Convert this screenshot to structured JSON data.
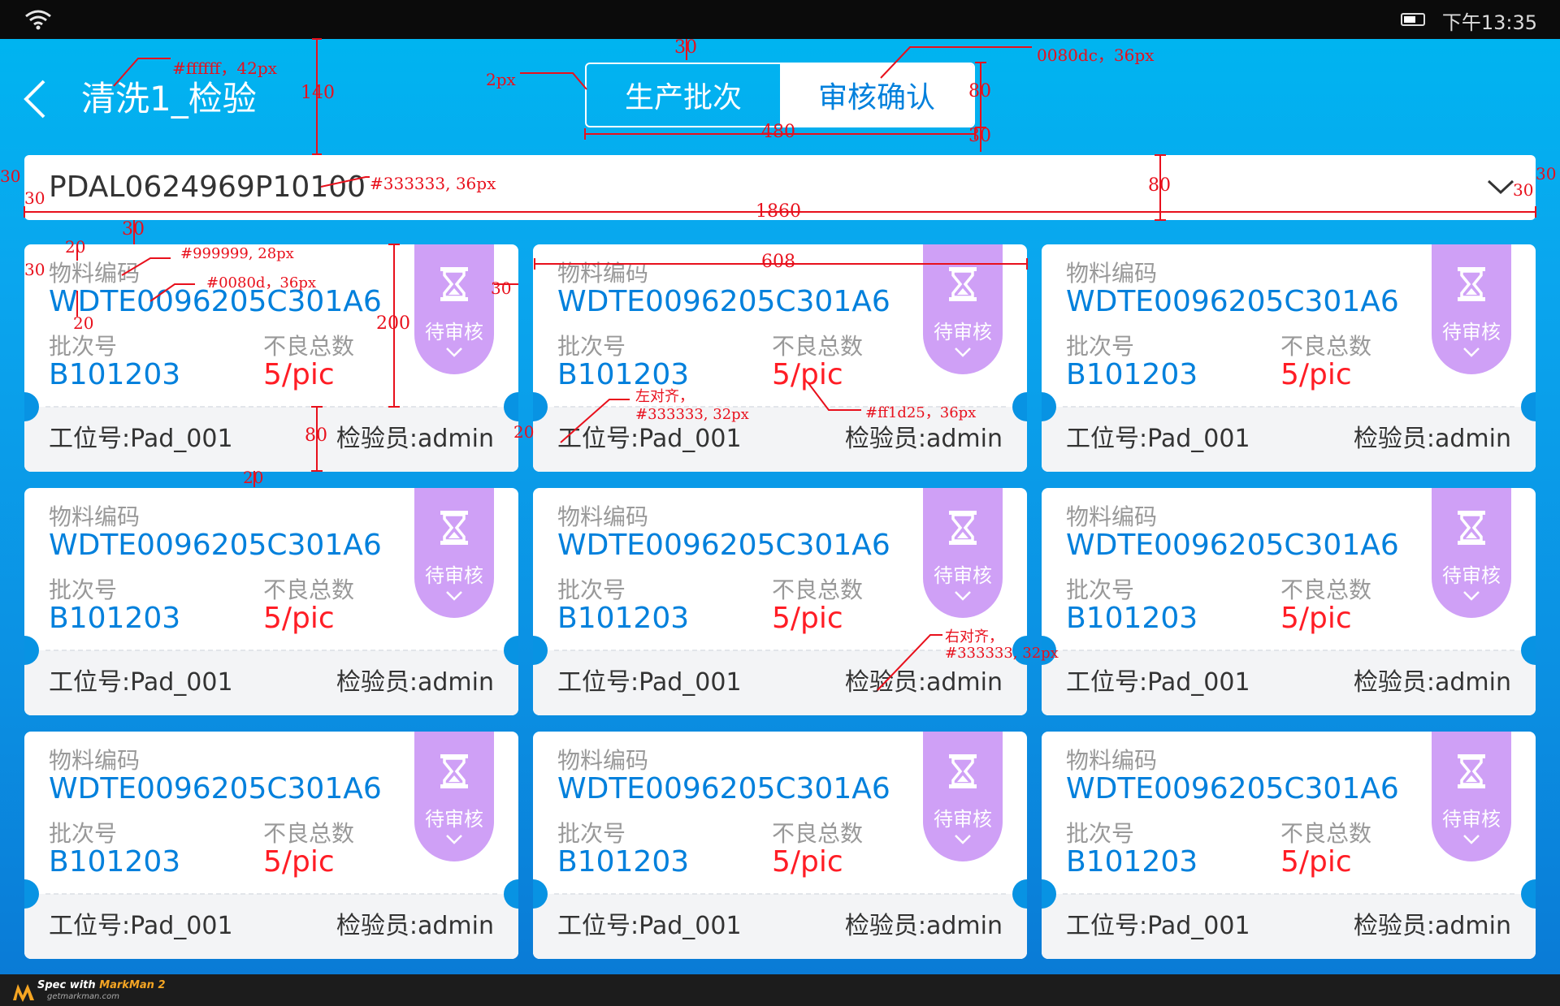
{
  "statusbar": {
    "time": "下午13:35"
  },
  "header": {
    "title": "清洗1_检验",
    "tabs": [
      {
        "label": "生产批次",
        "active": false
      },
      {
        "label": "审核确认",
        "active": true
      }
    ]
  },
  "selector": {
    "value": "PDAL0624969P10100"
  },
  "cards": [
    {
      "material_label": "物料编码",
      "material_code": "WDTE0096205C301A6",
      "batch_label": "批次号",
      "batch_no": "B101203",
      "defect_label": "不良总数",
      "defect_value": "5/pic",
      "station": "工位号:Pad_001",
      "inspector": "检验员:admin",
      "status": "待审核"
    },
    {
      "material_label": "物料编码",
      "material_code": "WDTE0096205C301A6",
      "batch_label": "批次号",
      "batch_no": "B101203",
      "defect_label": "不良总数",
      "defect_value": "5/pic",
      "station": "工位号:Pad_001",
      "inspector": "检验员:admin",
      "status": "待审核"
    },
    {
      "material_label": "物料编码",
      "material_code": "WDTE0096205C301A6",
      "batch_label": "批次号",
      "batch_no": "B101203",
      "defect_label": "不良总数",
      "defect_value": "5/pic",
      "station": "工位号:Pad_001",
      "inspector": "检验员:admin",
      "status": "待审核"
    },
    {
      "material_label": "物料编码",
      "material_code": "WDTE0096205C301A6",
      "batch_label": "批次号",
      "batch_no": "B101203",
      "defect_label": "不良总数",
      "defect_value": "5/pic",
      "station": "工位号:Pad_001",
      "inspector": "检验员:admin",
      "status": "待审核"
    },
    {
      "material_label": "物料编码",
      "material_code": "WDTE0096205C301A6",
      "batch_label": "批次号",
      "batch_no": "B101203",
      "defect_label": "不良总数",
      "defect_value": "5/pic",
      "station": "工位号:Pad_001",
      "inspector": "检验员:admin",
      "status": "待审核"
    },
    {
      "material_label": "物料编码",
      "material_code": "WDTE0096205C301A6",
      "batch_label": "批次号",
      "batch_no": "B101203",
      "defect_label": "不良总数",
      "defect_value": "5/pic",
      "station": "工位号:Pad_001",
      "inspector": "检验员:admin",
      "status": "待审核"
    },
    {
      "material_label": "物料编码",
      "material_code": "WDTE0096205C301A6",
      "batch_label": "批次号",
      "batch_no": "B101203",
      "defect_label": "不良总数",
      "defect_value": "5/pic",
      "station": "工位号:Pad_001",
      "inspector": "检验员:admin",
      "status": "待审核"
    },
    {
      "material_label": "物料编码",
      "material_code": "WDTE0096205C301A6",
      "batch_label": "批次号",
      "batch_no": "B101203",
      "defect_label": "不良总数",
      "defect_value": "5/pic",
      "station": "工位号:Pad_001",
      "inspector": "检验员:admin",
      "status": "待审核"
    },
    {
      "material_label": "物料编码",
      "material_code": "WDTE0096205C301A6",
      "batch_label": "批次号",
      "batch_no": "B101203",
      "defect_label": "不良总数",
      "defect_value": "5/pic",
      "station": "工位号:Pad_001",
      "inspector": "检验员:admin",
      "status": "待审核"
    }
  ],
  "icons": {
    "back": "chevron-left-icon",
    "dropdown": "chevron-down-icon",
    "status": "hourglass-icon",
    "wifi": "wifi-icon",
    "battery": "battery-icon"
  },
  "colors": {
    "title_text": "#ffffff",
    "value_text": "#333333",
    "label_text": "#999999",
    "blue": "#0080dc",
    "red": "#ff1d25",
    "badge": "#cfa0f6",
    "annotation": "#e8101c"
  },
  "annotations": [
    {
      "id": "title-spec",
      "text": "#ffffff，42px"
    },
    {
      "id": "header-height",
      "text": "140"
    },
    {
      "id": "seg-top",
      "text": "30"
    },
    {
      "id": "seg-border",
      "text": "2px"
    },
    {
      "id": "seg-spec",
      "text": "0080dc，36px"
    },
    {
      "id": "seg-height",
      "text": "80"
    },
    {
      "id": "seg-width",
      "text": "480"
    },
    {
      "id": "seg-bottom",
      "text": "30"
    },
    {
      "id": "select-left-outer",
      "text": "30"
    },
    {
      "id": "select-left-inner",
      "text": "30"
    },
    {
      "id": "select-spec",
      "text": "#333333, 36px"
    },
    {
      "id": "select-height",
      "text": "80"
    },
    {
      "id": "select-right-inner",
      "text": "30"
    },
    {
      "id": "select-right-outer",
      "text": "30"
    },
    {
      "id": "select-width",
      "text": "1860"
    },
    {
      "id": "grid-top",
      "text": "30"
    },
    {
      "id": "card-pad-top",
      "text": "20"
    },
    {
      "id": "card-left",
      "text": "30"
    },
    {
      "id": "label-spec",
      "text": "#999999, 28px"
    },
    {
      "id": "blue-spec",
      "text": "#0080d，36px"
    },
    {
      "id": "row-gap",
      "text": "20"
    },
    {
      "id": "upper-height",
      "text": "200"
    },
    {
      "id": "badge-right",
      "text": "30"
    },
    {
      "id": "card-width",
      "text": "608"
    },
    {
      "id": "align-left",
      "text": "左对齐，"
    },
    {
      "id": "align-left-spec",
      "text": "#333333, 32px"
    },
    {
      "id": "red-spec",
      "text": "#ff1d25，36px"
    },
    {
      "id": "card-gap",
      "text": "20"
    },
    {
      "id": "footer-height",
      "text": "80"
    },
    {
      "id": "card-row-gap",
      "text": "20"
    },
    {
      "id": "align-right",
      "text": "右对齐，"
    },
    {
      "id": "align-right-spec",
      "text": "#333333, 32px"
    }
  ],
  "footer": {
    "brand_prefix": "Spec with ",
    "brand_name": "MarkMan 2",
    "url": "getmarkman.com"
  }
}
